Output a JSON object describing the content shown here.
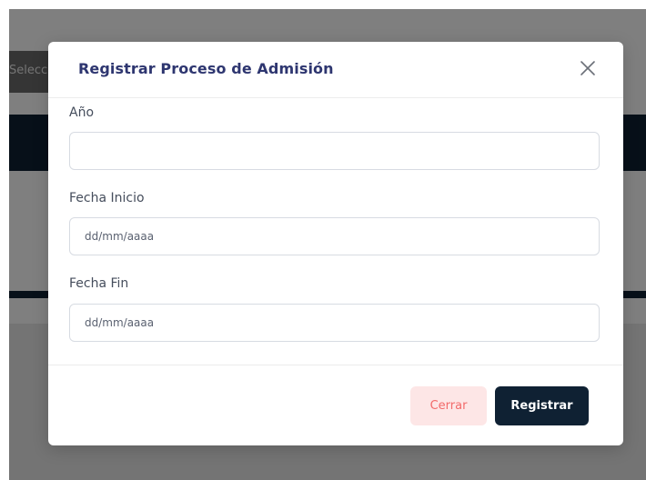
{
  "background": {
    "select_chip_text": "Seleccion",
    "colors": {
      "navbar": "#0f2133",
      "overlay": "rgba(0,0,0,0.5)"
    }
  },
  "modal": {
    "title": "Registrar Proceso de Admisión",
    "close_icon": "close-icon",
    "fields": [
      {
        "label": "Año",
        "value": "",
        "placeholder": ""
      },
      {
        "label": "Fecha Inicio",
        "value": "",
        "placeholder": "dd/mm/aaaa"
      },
      {
        "label": "Fecha Fin",
        "value": "",
        "placeholder": "dd/mm/aaaa"
      }
    ],
    "buttons": {
      "close_label": "Cerrar",
      "register_label": "Registrar"
    },
    "colors": {
      "title": "#2e3670",
      "primary": "#0f2133",
      "danger_text": "#f26a6a",
      "danger_bg": "#fde6e6"
    }
  }
}
